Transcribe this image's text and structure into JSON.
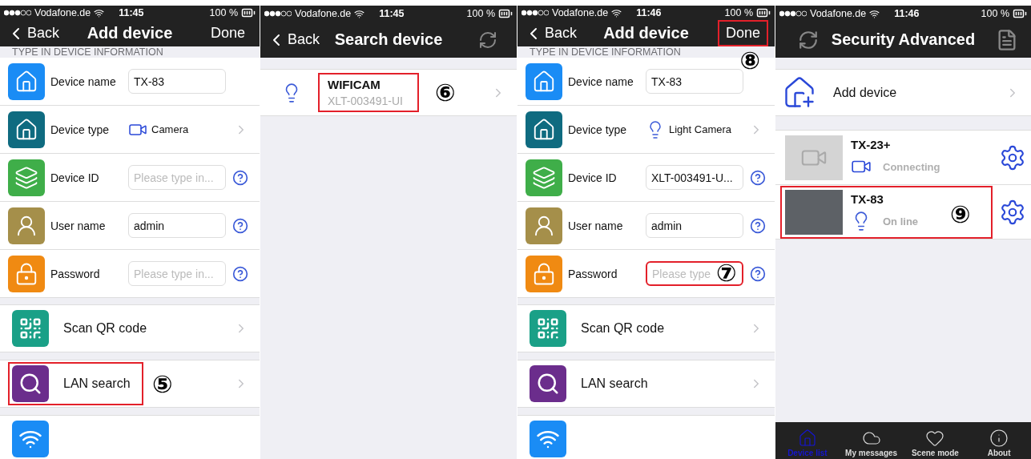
{
  "screens": [
    {
      "kind": "form",
      "status": {
        "carrier": "Vodafone.de",
        "time": "11:45",
        "battery": "100 %"
      },
      "nav": {
        "back": "Back",
        "title": "Add device",
        "action": "Done",
        "action_highlighted": false
      },
      "section": "TYPE IN DEVICE INFORMATION",
      "fields": [
        {
          "kind": "input",
          "label": "Device name",
          "value": "TX-83",
          "help": false,
          "color": "#1a8cf5"
        },
        {
          "kind": "select",
          "label": "Device type",
          "value": "Camera",
          "device": {
            "kind": "camera"
          },
          "color": "#0f6b80"
        },
        {
          "kind": "input",
          "label": "Device ID",
          "placeholder": "Please type in...",
          "help": true,
          "color": "#3fae49"
        },
        {
          "kind": "input",
          "label": "User name",
          "value": "admin",
          "help": true,
          "color": "#a58f4a"
        },
        {
          "kind": "input",
          "label": "Password",
          "placeholder": "Please type in...",
          "help": true,
          "color": "#f08a12"
        }
      ],
      "actions": [
        {
          "label": "Scan QR code",
          "color": "#1aa087",
          "highlighted": false
        },
        {
          "label": "LAN search",
          "color": "#6b2d8c",
          "highlighted": true,
          "callout": "⑤"
        },
        {
          "color": "#1a8cf5",
          "highlighted": false
        }
      ]
    },
    {
      "kind": "search",
      "status": {
        "carrier": "Vodafone.de",
        "time": "11:45",
        "battery": "100 %"
      },
      "nav": {
        "back": "Back",
        "title": "Search device"
      },
      "results": [
        {
          "name": "WIFICAM",
          "id": "XLT-003491-UI",
          "highlighted": true,
          "callout": "⑥"
        }
      ]
    },
    {
      "kind": "form",
      "status": {
        "carrier": "Vodafone.de",
        "time": "11:46",
        "battery": "100 %"
      },
      "nav": {
        "back": "Back",
        "title": "Add device",
        "action": "Done",
        "action_highlighted": true,
        "action_callout": "⑧"
      },
      "section": "TYPE IN DEVICE INFORMATION",
      "fields": [
        {
          "kind": "input",
          "label": "Device name",
          "value": "TX-83",
          "help": false,
          "color": "#1a8cf5"
        },
        {
          "kind": "select",
          "label": "Device type",
          "value": "Light Camera",
          "device": {
            "kind": "light"
          },
          "color": "#0f6b80"
        },
        {
          "kind": "input",
          "label": "Device ID",
          "value": "XLT-003491-U...",
          "help": true,
          "color": "#3fae49"
        },
        {
          "kind": "input",
          "label": "User name",
          "value": "admin",
          "help": true,
          "color": "#a58f4a"
        },
        {
          "kind": "input",
          "label": "Password",
          "placeholder": "Please type",
          "help": true,
          "color": "#f08a12",
          "highlighted": true,
          "callout": "⑦"
        }
      ],
      "actions": [
        {
          "label": "Scan QR code",
          "color": "#1aa087",
          "highlighted": false
        },
        {
          "label": "LAN search",
          "color": "#6b2d8c",
          "highlighted": false
        },
        {
          "color": "#1a8cf5",
          "highlighted": false
        }
      ]
    },
    {
      "kind": "list",
      "status": {
        "carrier": "Vodafone.de",
        "time": "11:46",
        "battery": "100 %"
      },
      "nav": {
        "title": "Security Advanced"
      },
      "add": "Add device",
      "devices": [
        {
          "name": "TX-23+",
          "kind": "camera",
          "state": "Connecting",
          "online": false,
          "highlighted": false
        },
        {
          "name": "TX-83",
          "kind": "light",
          "state": "On line",
          "online": true,
          "highlighted": true,
          "callout": "⑨"
        }
      ],
      "tabs": [
        {
          "label": "Device list",
          "selected": true
        },
        {
          "label": "My messages",
          "selected": false
        },
        {
          "label": "Scene mode",
          "selected": false
        },
        {
          "label": "About",
          "selected": false
        }
      ]
    }
  ]
}
